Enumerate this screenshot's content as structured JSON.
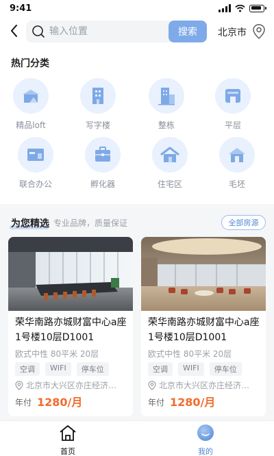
{
  "status_bar": {
    "time": "9:41"
  },
  "header": {
    "search_placeholder": "输入位置",
    "search_button": "搜索",
    "city": "北京市"
  },
  "hot": {
    "title": "热门分类",
    "items": [
      {
        "label": "精品loft",
        "icon": "loft-icon"
      },
      {
        "label": "写字楼",
        "icon": "office-building-icon"
      },
      {
        "label": "整栋",
        "icon": "whole-building-icon"
      },
      {
        "label": "平层",
        "icon": "flat-floor-icon"
      },
      {
        "label": "联合办公",
        "icon": "coworking-icon"
      },
      {
        "label": "孵化器",
        "icon": "incubator-icon"
      },
      {
        "label": "住宅区",
        "icon": "residential-icon"
      },
      {
        "label": "毛坯",
        "icon": "bare-shell-icon"
      }
    ]
  },
  "picks": {
    "title": "为您精选",
    "subtitle": "专业品牌，质量保证",
    "all_button": "全部房源",
    "cards": [
      {
        "title": "荣华南路亦城财富中心a座1号楼10层D1001",
        "spec": "欧式中性 80平米 20层",
        "tags": [
          "空调",
          "WIFI",
          "停车位"
        ],
        "address": "北京市大兴区亦庄经济…",
        "pay_label": "年付",
        "price": "1280/月"
      },
      {
        "title": "荣华南路亦城财富中心a座1号楼10层D1001",
        "spec": "欧式中性 80平米 20层",
        "tags": [
          "空调",
          "WIFI",
          "停车位"
        ],
        "address": "北京市大兴区亦庄经济…",
        "pay_label": "年付",
        "price": "1280/月"
      }
    ]
  },
  "tabbar": {
    "items": [
      {
        "label": "首页",
        "icon": "home-icon",
        "active": true
      },
      {
        "label": "我的",
        "icon": "profile-icon",
        "active": false
      }
    ]
  },
  "colors": {
    "accent": "#7faae9",
    "price": "#f26b2d",
    "icon_bg": "#e8f1fd",
    "icon_fill": "#7ea9e6"
  }
}
